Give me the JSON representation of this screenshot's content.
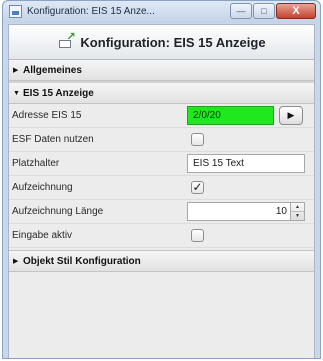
{
  "window": {
    "title": "Konfiguration: EIS 15 Anze...",
    "minimize_glyph": "—",
    "maximize_glyph": "□",
    "close_glyph": "X"
  },
  "header": {
    "title": "Konfiguration: EIS 15 Anzeige",
    "icon": "export-arrow-icon"
  },
  "sections": {
    "allgemeines": {
      "label": "Allgemeines",
      "expanded": false,
      "toggle_glyph": "▶"
    },
    "eis15": {
      "label": "EIS 15 Anzeige",
      "expanded": true,
      "toggle_glyph": "▼"
    },
    "objekt_stil": {
      "label": "Objekt Stil Konfiguration",
      "expanded": false,
      "toggle_glyph": "▶"
    }
  },
  "fields": {
    "adresse": {
      "label": "Adresse EIS 15",
      "value": "2/0/20",
      "color": "#1fe81f",
      "button_glyph": "▶"
    },
    "esf": {
      "label": "ESF Daten nutzen",
      "checked": false,
      "mark": ""
    },
    "platzhalter": {
      "label": "Platzhalter",
      "value": "EIS 15 Text"
    },
    "aufzeichnung": {
      "label": "Aufzeichnung",
      "checked": true,
      "mark": "✓"
    },
    "laenge": {
      "label": "Aufzeichnung Länge",
      "value": "10",
      "up_glyph": "▲",
      "down_glyph": "▼"
    },
    "eingabe": {
      "label": "Eingabe aktiv",
      "checked": false,
      "mark": ""
    }
  }
}
